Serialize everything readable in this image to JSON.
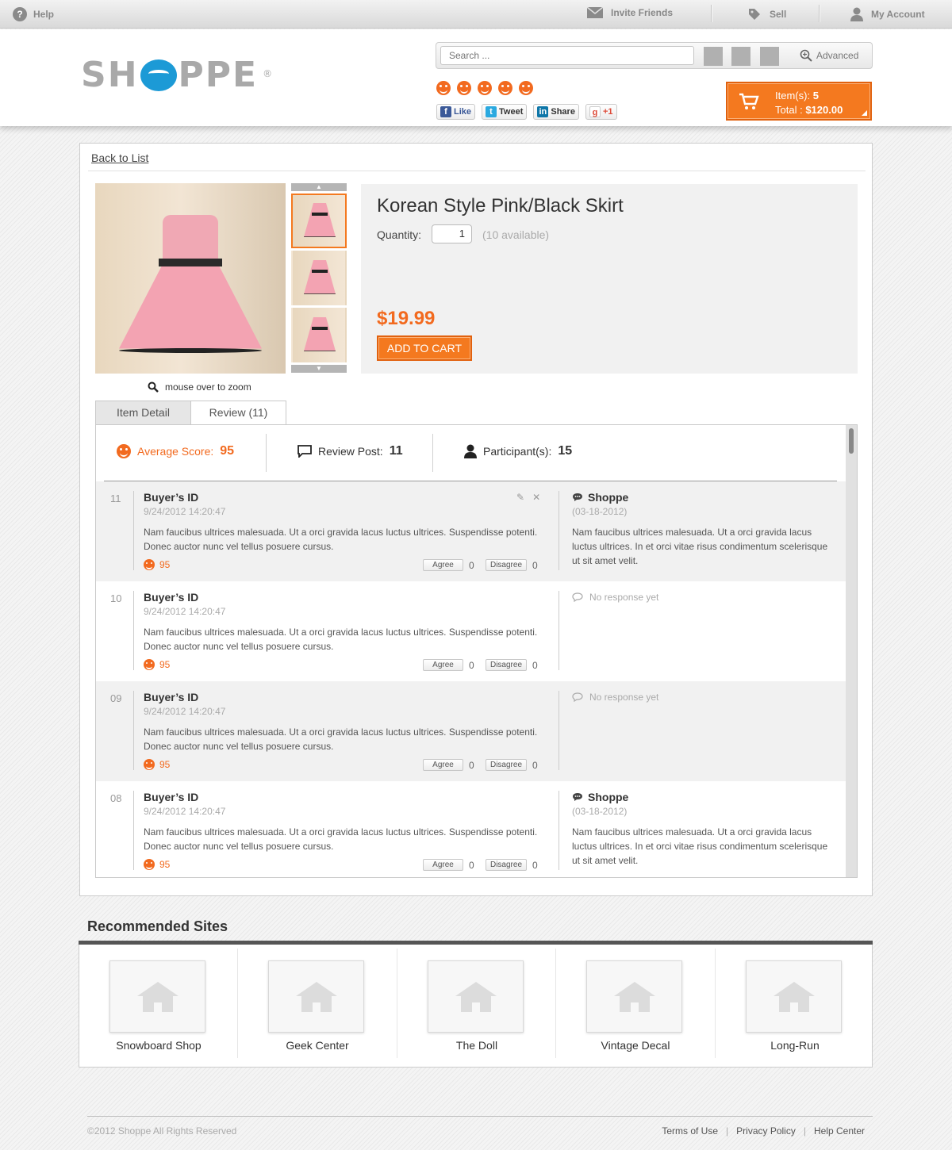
{
  "topbar": {
    "help": "Help",
    "invite": "Invite Friends",
    "sell": "Sell",
    "account": "My Account"
  },
  "header": {
    "logo_left": "SH",
    "logo_right": "PPE",
    "logo_reg": "®",
    "search_placeholder": "Search ...",
    "advanced": "Advanced",
    "social": {
      "like": "Like",
      "tweet": "Tweet",
      "share": "Share",
      "plus": "+1"
    },
    "cart": {
      "items_label": "Item(s):",
      "items_value": "5",
      "total_label": "Total :",
      "total_value": "$120.00"
    }
  },
  "product": {
    "back": "Back to List",
    "title": "Korean Style Pink/Black Skirt",
    "quantity_label": "Quantity:",
    "quantity_value": "1",
    "available": "(10 available)",
    "price": "$19.99",
    "add_to_cart": "ADD TO CART",
    "zoom_hint": "mouse over to zoom"
  },
  "tabs": [
    "Item Detail",
    "Review (11)"
  ],
  "stats": {
    "avg_label": "Average Score:",
    "avg_value": "95",
    "posts_label": "Review Post:",
    "posts_value": "11",
    "participants_label": "Participant(s):",
    "participants_value": "15"
  },
  "reviews": [
    {
      "num": "11",
      "buyer": "Buyer’s ID",
      "date": "9/24/2012 14:20:47",
      "body": "Nam faucibus ultrices malesuada. Ut a orci gravida lacus luctus ultrices. Suspendisse potenti. Donec auctor nunc vel tellus posuere cursus.",
      "score": "95",
      "agree": "Agree",
      "agree_count": "0",
      "disagree": "Disagree",
      "disagree_count": "0",
      "response_from": "Shoppe",
      "response_date": "(03-18-2012)",
      "response_body": "Nam faucibus ultrices malesuada. Ut a orci gravida lacus luctus ultrices. In et orci vitae risus condimentum scelerisque ut sit amet velit."
    },
    {
      "num": "10",
      "buyer": "Buyer’s ID",
      "date": "9/24/2012 14:20:47",
      "body": "Nam faucibus ultrices malesuada. Ut a orci gravida lacus luctus ultrices. Suspendisse potenti. Donec auctor nunc vel tellus posuere cursus.",
      "score": "95",
      "agree": "Agree",
      "agree_count": "0",
      "disagree": "Disagree",
      "disagree_count": "0",
      "no_response": "No response yet"
    },
    {
      "num": "09",
      "buyer": "Buyer’s ID",
      "date": "9/24/2012 14:20:47",
      "body": "Nam faucibus ultrices malesuada. Ut a orci gravida lacus luctus ultrices. Suspendisse potenti. Donec auctor nunc vel tellus posuere cursus.",
      "score": "95",
      "agree": "Agree",
      "agree_count": "0",
      "disagree": "Disagree",
      "disagree_count": "0",
      "no_response": "No response yet"
    },
    {
      "num": "08",
      "buyer": "Buyer’s ID",
      "date": "9/24/2012 14:20:47",
      "body": "Nam faucibus ultrices malesuada. Ut a orci gravida lacus luctus ultrices. Suspendisse potenti. Donec auctor nunc vel tellus posuere cursus.",
      "score": "95",
      "agree": "Agree",
      "agree_count": "0",
      "disagree": "Disagree",
      "disagree_count": "0",
      "response_from": "Shoppe",
      "response_date": "(03-18-2012)",
      "response_body": "Nam faucibus ultrices malesuada. Ut a orci gravida lacus luctus ultrices. In et orci vitae risus condimentum scelerisque ut sit amet velit."
    }
  ],
  "recommended": {
    "title": "Recommended Sites",
    "sites": [
      "Snowboard Shop",
      "Geek Center",
      "The Doll",
      "Vintage Decal",
      "Long-Run"
    ]
  },
  "footer": {
    "copyright": "©2012 Shoppe All Rights Reserved",
    "links": [
      "Terms of Use",
      "Privacy Policy",
      "Help Center"
    ],
    "separator": "|"
  },
  "colors": {
    "accent": "#f4791f",
    "brand_blue": "#1c9ad6",
    "bar_dark": "#555555"
  }
}
